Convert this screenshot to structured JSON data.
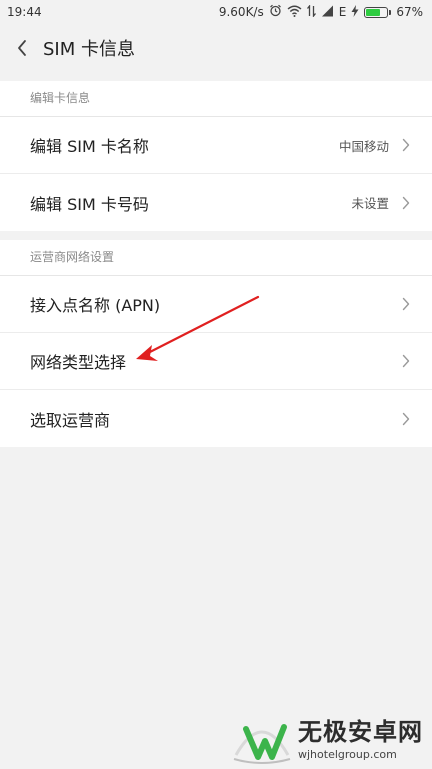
{
  "status_bar": {
    "time": "19:44",
    "net_speed": "9.60K/s",
    "network_type": "E",
    "battery_level": "67%",
    "battery_fraction": 0.67,
    "icons": [
      "alarm-icon",
      "wifi-icon",
      "data-transfer-icon",
      "signal-icon",
      "charging-icon",
      "battery-icon"
    ]
  },
  "header": {
    "title": "SIM 卡信息",
    "back_icon": "chevron-left-icon"
  },
  "sections": {
    "edit": {
      "title": "编辑卡信息",
      "rows": [
        {
          "label": "编辑 SIM 卡名称",
          "value": "中国移动"
        },
        {
          "label": "编辑 SIM 卡号码",
          "value": "未设置"
        }
      ]
    },
    "carrier": {
      "title": "运营商网络设置",
      "rows": [
        {
          "label": "接入点名称 (APN)"
        },
        {
          "label": "网络类型选择"
        },
        {
          "label": "选取运营商"
        }
      ]
    }
  },
  "annotation": {
    "type": "arrow",
    "color": "#e02020",
    "target": "网络类型选择"
  },
  "watermark": {
    "title": "无极安卓网",
    "url": "wjhotelgroup.com",
    "colors": {
      "green": "#3cb44b",
      "dark": "#2d2d2d"
    }
  }
}
